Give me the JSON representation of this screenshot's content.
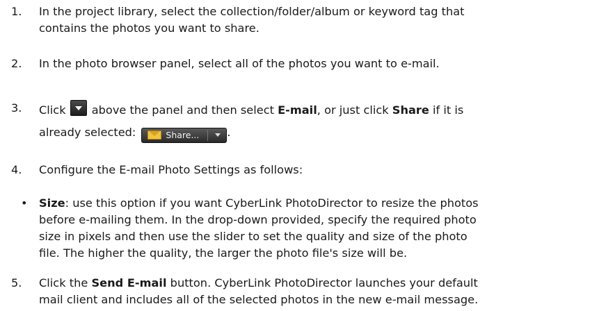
{
  "steps": [
    {
      "num": "1.",
      "line1": "In the project library, select the collection/folder/album or keyword tag that",
      "line2": "contains the photos you want to share."
    },
    {
      "num": "2.",
      "text": "In the photo browser panel, select all of the photos you want to e-mail."
    },
    {
      "num": "3.",
      "click": "Click",
      "mid": "above the panel and then select",
      "email_bold": "E-mail",
      "or_text": ", or just click",
      "share_bold": "Share",
      "if_text": "if it is",
      "already": "already selected:",
      "share_button_label": "Share...",
      "end": "."
    },
    {
      "num": "4.",
      "text": "Configure the E-mail Photo Settings as follows:"
    },
    {
      "num": "5.",
      "click": "Click the",
      "send_bold": "Send E-mail",
      "rest1": "button. CyberLink PhotoDirector launches your default",
      "line2": "mail client and includes all of the selected photos in the new e-mail message."
    }
  ],
  "bullet": {
    "marker": "•",
    "term": "Size",
    "line1": ": use this option if you want CyberLink PhotoDirector to resize the photos",
    "line2": "before e-mailing them. In the drop-down provided, specify the required photo",
    "line3": "size in pixels and then use the slider to set the quality and size of the photo",
    "line4": "file. The higher the quality, the larger the photo file's size will be."
  },
  "icons": {
    "dropdown_arrow": "dropdown-arrow-icon",
    "envelope": "envelope-icon"
  },
  "colors": {
    "text": "#1a1a1a",
    "envelope": "#f3c33d",
    "button_dark": "#2a2a2a"
  }
}
